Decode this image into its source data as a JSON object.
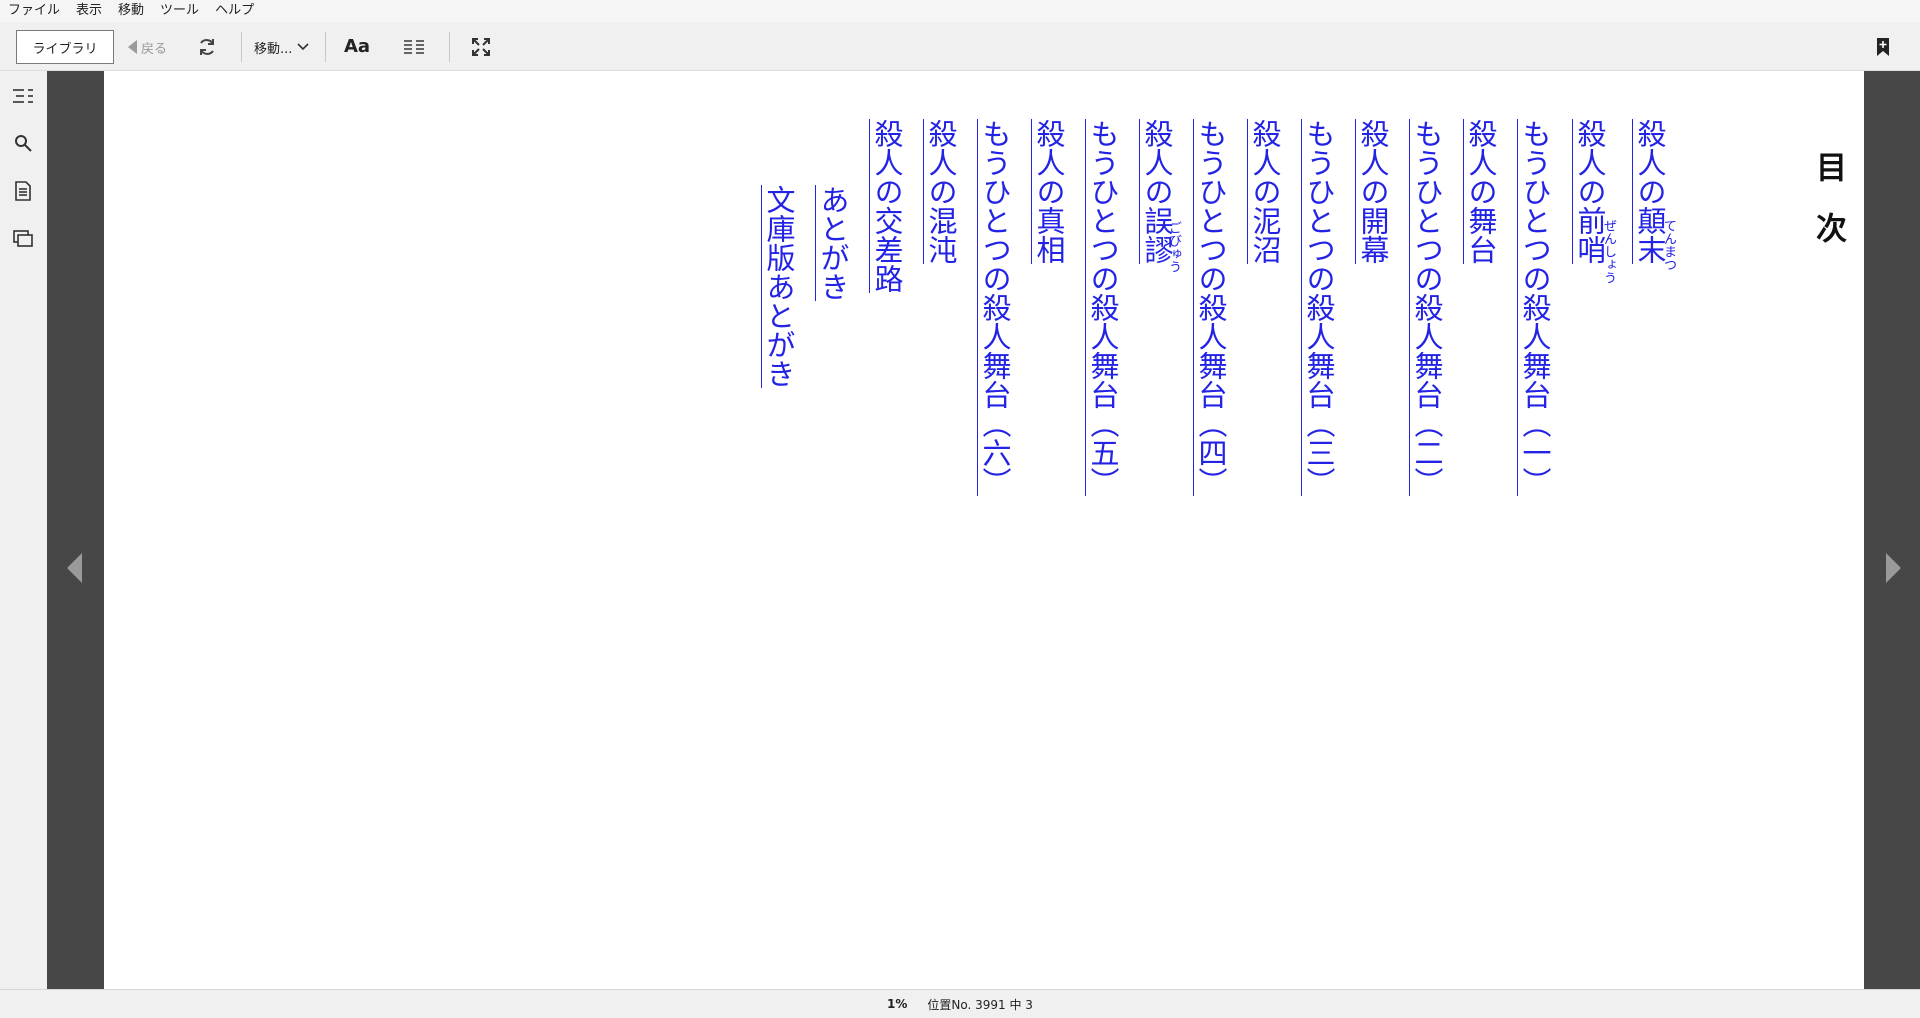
{
  "menubar": {
    "items": [
      "ファイル",
      "表示",
      "移動",
      "ツール",
      "ヘルプ"
    ]
  },
  "toolbar": {
    "library_label": "ライブラリ",
    "back_label": "戻る",
    "goto_label": "移動...",
    "font_label": "Aa"
  },
  "toc": {
    "title": "目次",
    "items": [
      {
        "label": "殺人の顛末",
        "ruby": "てんまつ"
      },
      {
        "label": "殺人の前哨",
        "ruby": "ぜんしょう"
      },
      {
        "label": "もうひとつの殺人舞台（一）"
      },
      {
        "label": "殺人の舞台"
      },
      {
        "label": "もうひとつの殺人舞台（二）"
      },
      {
        "label": "殺人の開幕"
      },
      {
        "label": "もうひとつの殺人舞台（三）"
      },
      {
        "label": "殺人の泥沼"
      },
      {
        "label": "もうひとつの殺人舞台（四）"
      },
      {
        "label": "殺人の誤謬",
        "ruby": "ごびゅう"
      },
      {
        "label": "もうひとつの殺人舞台（五）"
      },
      {
        "label": "殺人の真相"
      },
      {
        "label": "もうひとつの殺人舞台（六）"
      },
      {
        "label": "殺人の混沌"
      },
      {
        "label": "殺人の交差路"
      },
      {
        "label": "あとがき"
      },
      {
        "label": "文庫版あとがき"
      }
    ]
  },
  "status": {
    "progress_percent": "1%",
    "location": "位置No. 3991 中 3"
  },
  "colors": {
    "link": "#2323e6",
    "gutter": "#474747",
    "chrome": "#f0f0f0"
  }
}
